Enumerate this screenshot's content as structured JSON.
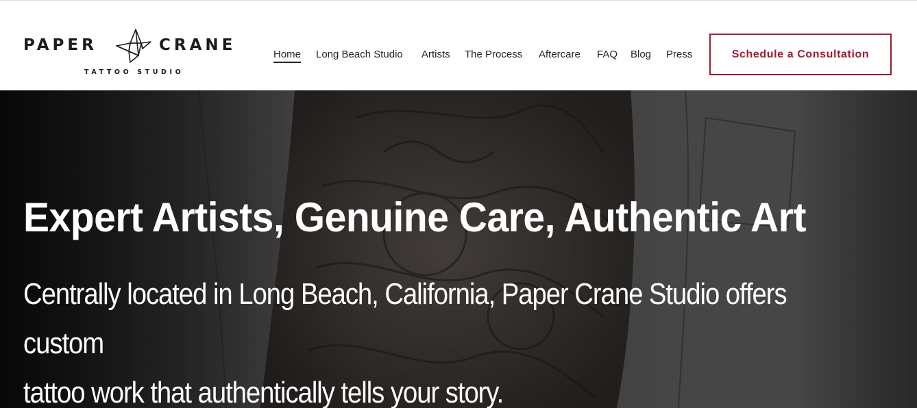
{
  "brand": {
    "word_left": "PAPER",
    "word_right": "CRANE",
    "tagline": "TATTOO STUDIO",
    "icon": "paper-crane-icon"
  },
  "nav": {
    "items": [
      {
        "label": "Home",
        "active": true
      },
      {
        "label": "Long Beach Studio",
        "active": false
      },
      {
        "label": "Artists",
        "active": false
      },
      {
        "label": "The Process",
        "active": false
      },
      {
        "label": "Aftercare",
        "active": false
      },
      {
        "label": "FAQ",
        "active": false
      },
      {
        "label": "Blog",
        "active": false
      },
      {
        "label": "Press",
        "active": false
      }
    ]
  },
  "cta": {
    "label": "Schedule a Consultation",
    "color": "#9e1b32"
  },
  "hero": {
    "title": "Expert Artists, Genuine Care, Authentic Art",
    "subtitle_line1": "Centrally located in Long Beach, California, Paper Crane Studio offers custom",
    "subtitle_line2": "tattoo work that authentically tells your story."
  }
}
